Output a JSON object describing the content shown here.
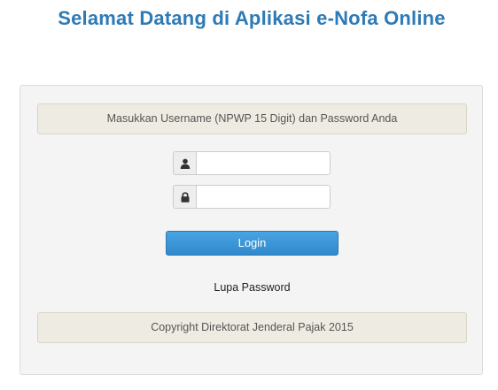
{
  "header": {
    "title": "Selamat Datang di Aplikasi e-Nofa Online"
  },
  "login_panel": {
    "instruction": "Masukkan Username (NPWP 15 Digit) dan Password Anda",
    "username": {
      "icon": "user-icon",
      "value": "",
      "placeholder": ""
    },
    "password": {
      "icon": "lock-icon",
      "value": "",
      "placeholder": ""
    },
    "login_label": "Login",
    "forgot_password_label": "Lupa Password",
    "copyright": "Copyright Direktorat Jenderal Pajak 2015"
  },
  "colors": {
    "title": "#2e7ab5",
    "button": "#3a95d6",
    "notice_bg": "#eeece2",
    "panel_bg": "#f4f4f4"
  }
}
